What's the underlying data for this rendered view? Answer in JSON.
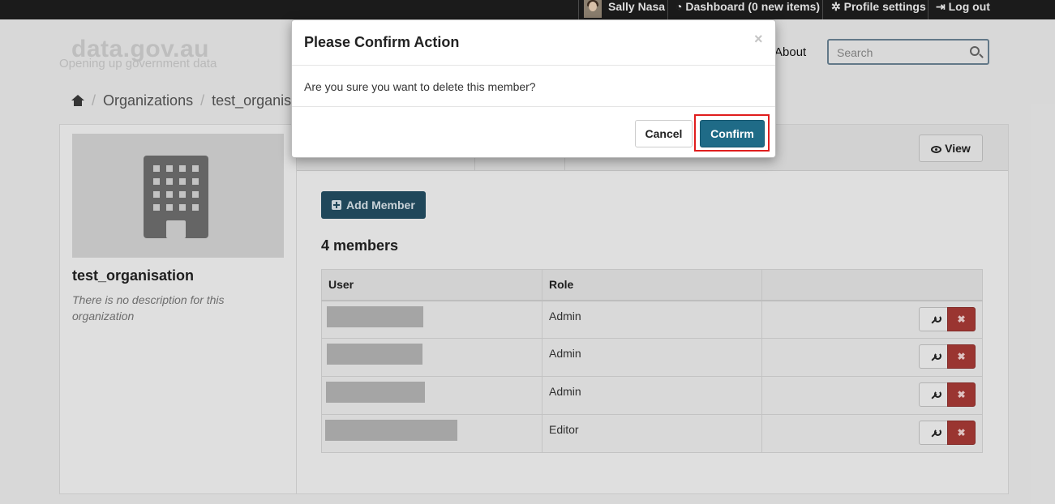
{
  "account": {
    "user_name": "Sally Nasa",
    "dashboard": "Dashboard (0 new items)",
    "profile": "Profile settings",
    "logout": "Log out"
  },
  "masthead": {
    "site_title": "data.gov.au",
    "site_subtitle": "Opening up government data",
    "nav_about": "About",
    "search_placeholder": "Search"
  },
  "breadcrumb": {
    "items": [
      "Organizations",
      "test_organis"
    ]
  },
  "org": {
    "name": "test_organisation",
    "description": "There is no description for this organization"
  },
  "main": {
    "view_label": "View",
    "add_member_label": "Add Member",
    "members_count": "4 members",
    "table": {
      "headers": [
        "User",
        "Role",
        ""
      ],
      "rows": [
        {
          "role": "Admin"
        },
        {
          "role": "Admin"
        },
        {
          "role": "Admin"
        },
        {
          "role": "Editor"
        }
      ]
    },
    "delete_glyph": "✖"
  },
  "modal": {
    "title": "Please Confirm Action",
    "close_glyph": "×",
    "message": "Are you sure you want to delete this member?",
    "cancel_label": "Cancel",
    "confirm_label": "Confirm"
  },
  "colors": {
    "primary": "#1f6b87",
    "danger": "#a83a36",
    "highlight": "#e01d1d"
  }
}
